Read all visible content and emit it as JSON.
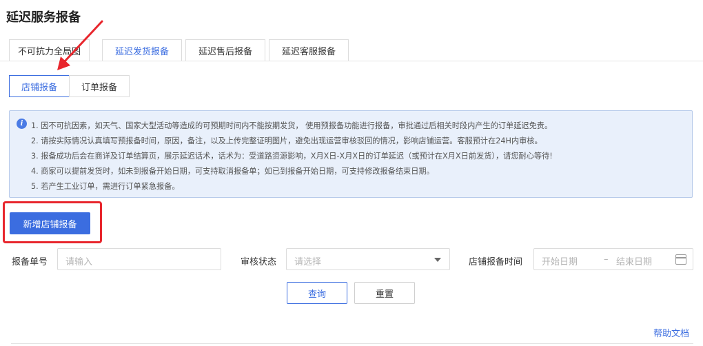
{
  "page_title": "延迟服务报备",
  "tabs": [
    {
      "label": "不可抗力全局图",
      "active": false
    },
    {
      "label": "延迟发货报备",
      "active": true
    },
    {
      "label": "延迟售后报备",
      "active": false
    },
    {
      "label": "延迟客服报备",
      "active": false
    }
  ],
  "subtabs": [
    {
      "label": "店铺报备",
      "active": true
    },
    {
      "label": "订单报备",
      "active": false
    }
  ],
  "notice": {
    "icon": "info-icon",
    "lines": [
      "1. 因不可抗因素，如天气、国家大型活动等造成的可预期时间内不能按期发货， 使用预报备功能进行报备，审批通过后相关时段内产生的订单延迟免责。",
      "2. 请按实际情况认真填写预报备时间，原因，备注，以及上传完整证明图片，避免出现运营审核驳回的情况，影响店铺运营。客服预计在24H内审核。",
      "3. 报备成功后会在商详及订单结算页，展示延迟话术，话术为：受道路资源影响，X月X日-X月X日的订单延迟（或预计在X月X日前发货），请您耐心等待!",
      "4. 商家可以提前发货时，如未到报备开始日期，可支持取消报备单；如已到报备开始日期，可支持修改报备结束日期。",
      "5. 若产生工业订单，需进行订单紧急报备。"
    ]
  },
  "add_button": "新增店铺报备",
  "filters": {
    "order_no_label": "报备单号",
    "order_no_placeholder": "请输入",
    "status_label": "审核状态",
    "status_placeholder": "请选择",
    "time_label": "店铺报备时间",
    "start_placeholder": "开始日期",
    "range_sep": "–",
    "end_placeholder": "结束日期"
  },
  "actions": {
    "query": "查询",
    "reset": "重置"
  },
  "help_link": "帮助文档",
  "colors": {
    "accent": "#3b6de0",
    "highlight": "#e8262d",
    "notice_bg": "#e9f0fb"
  }
}
